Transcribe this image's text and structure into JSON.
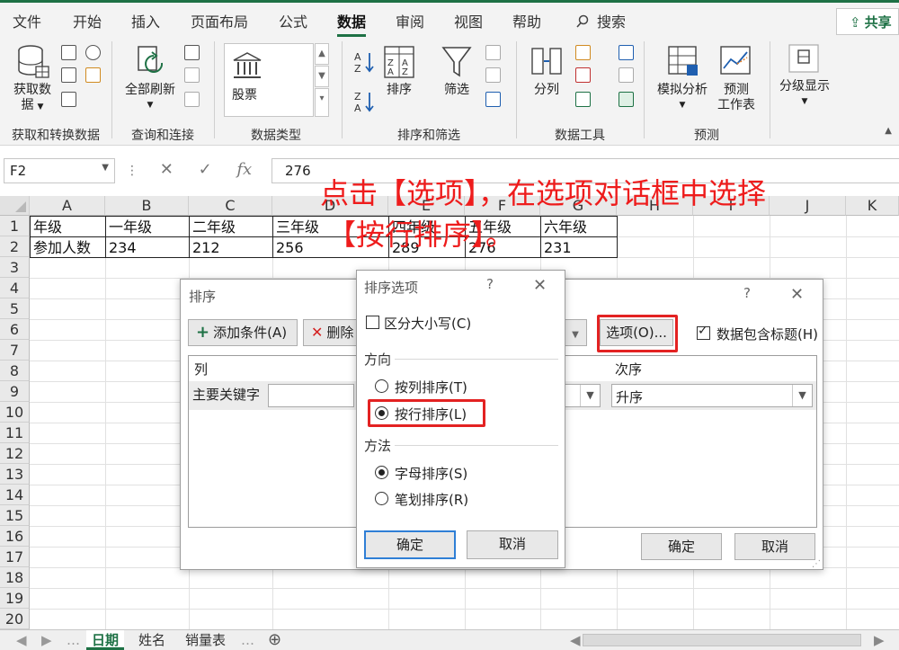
{
  "menu": {
    "tabs": [
      "文件",
      "开始",
      "插入",
      "页面布局",
      "公式",
      "数据",
      "审阅",
      "视图",
      "帮助"
    ],
    "active": "数据",
    "search_label": "搜索",
    "share_label": "共享"
  },
  "ribbon": {
    "groups": {
      "get_transform": "获取和转换数据",
      "queries": "查询和连接",
      "data_types": "数据类型",
      "sort_filter": "排序和筛选",
      "data_tools": "数据工具",
      "forecast": "预测"
    },
    "buttons": {
      "get_data_1": "获取数",
      "get_data_2": "据",
      "refresh_all": "全部刷新",
      "stocks": "股票",
      "sort": "排序",
      "filter": "筛选",
      "text_to_columns": "分列",
      "what_if": "模拟分析",
      "forecast_sheet_1": "预测",
      "forecast_sheet_2": "工作表",
      "outline": "分级显示"
    }
  },
  "formula_bar": {
    "name_box": "F2",
    "value": "276"
  },
  "sheet": {
    "columns": [
      "A",
      "B",
      "C",
      "D",
      "E",
      "F",
      "G",
      "H",
      "I",
      "J",
      "K"
    ],
    "rows": [
      "1",
      "2",
      "3",
      "4",
      "5",
      "6",
      "7",
      "8",
      "9",
      "10",
      "11",
      "12",
      "13",
      "14",
      "15",
      "16",
      "17",
      "18",
      "19",
      "20"
    ],
    "row1": [
      "年级",
      "一年级",
      "二年级",
      "三年级",
      "四年级",
      "五年级",
      "六年级"
    ],
    "row2": [
      "参加人数",
      "234",
      "212",
      "256",
      "289",
      "276",
      "231"
    ],
    "tabs": [
      "日期",
      "姓名",
      "销量表"
    ],
    "active_tab": "日期"
  },
  "annotation": {
    "line1": "点击【选项】，在选项对话框中选择",
    "line2": "【按行排序】。"
  },
  "sort_dialog": {
    "title": "排序",
    "add_condition": "添加条件(A)",
    "delete_condition": "删除",
    "options_button": "选项(O)...",
    "header_checkbox": "数据包含标题(H)",
    "header_checked": true,
    "col_header": "列",
    "order_header": "次序",
    "primary_key": "主要关键字",
    "order_value": "升序",
    "ok": "确定",
    "cancel": "取消",
    "help": "?",
    "close": "✕"
  },
  "options_dialog": {
    "title": "排序选项",
    "help": "?",
    "close": "✕",
    "case_sensitive": "区分大小写(C)",
    "direction_label": "方向",
    "by_column": "按列排序(T)",
    "by_row": "按行排序(L)",
    "method_label": "方法",
    "alphabetical": "字母排序(S)",
    "stroke": "笔划排序(R)",
    "ok": "确定",
    "cancel": "取消"
  },
  "colors": {
    "excel_green": "#1e7145",
    "annotation_red": "#ee1c1c",
    "highlight_red": "#e32222",
    "primary_blue": "#2f7fd6"
  }
}
